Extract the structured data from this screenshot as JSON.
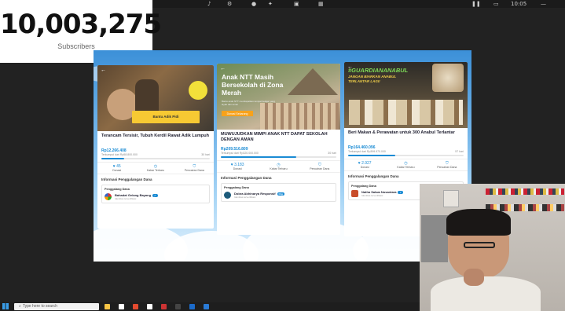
{
  "subscriber_widget": {
    "count": "10,003,275",
    "label": "Subscribers"
  },
  "top_icons": [
    "bell-icon",
    "settings-icon",
    "record-icon",
    "share-icon",
    "window-icon",
    "grid-icon",
    "pause-icon",
    "layout-icon",
    "minimize-icon"
  ],
  "top_time": "10:05",
  "cards": [
    {
      "title": "Terancam Tersisir, Tubuh Kerdil Rawat Adik Lumpuh",
      "banner": "Bantu Adik Pidi",
      "amount": "Rp12.266.408",
      "target": "Terkumpul dari Rp58.800.000",
      "days": "30 hari",
      "progress": 0.21,
      "actions": {
        "count": "45",
        "donasi": "Donasi",
        "kabar": "Kabar Terbaru",
        "pencairan": "Pencairan Dana"
      },
      "info_title": "Informasi Penggalangan Dana",
      "org_label": "Penggalang Dana",
      "org_name": "Bahadat Gelang Bayang",
      "org_badge": "✓",
      "org_sub": "Identitas terverifikasi"
    },
    {
      "hero_title": "Anak NTT Masih Bersekolah di Zona Merah",
      "hero_sub": "Bantu anak NTT mendapatkan tempat belajar yang layak dan aman",
      "hero_button": "Donasi Sekarang",
      "title": "MUWUJUDKAN MIMPI ANAK NTT DAPAT SEKOLAH DENGAN AMAN",
      "amount": "Rp209.516.809",
      "target": "Terkumpul dari Rp320.000.000",
      "days": "30 hari",
      "progress": 0.65,
      "actions": {
        "count": "3.183",
        "donasi": "Donasi",
        "kabar": "Kabar Terbaru",
        "pencairan": "Pencairan Dana"
      },
      "info_title": "Informasi Penggalangan Dana",
      "org_label": "Penggalang Dana",
      "org_name": "Dobra Abhinarya Responsif",
      "org_badge": "Org",
      "org_sub": "Identitas terverifikasi"
    },
    {
      "hero_title": "#GUARDIANANABUL",
      "hero_sub": "JANGAN BIARKAN ANABUL TERLANTAR LAGI!",
      "title": "Beri Makan & Perawatan untuk 300 Anabul Terlantar",
      "amount": "Rp164.460.096",
      "target": "Terkumpul dari Rp399.970.000",
      "days": "57 hari",
      "progress": 0.41,
      "actions": {
        "count": "2.927",
        "donasi": "Donasi",
        "kabar": "Kabar Terbaru",
        "pencairan": "Pencairan Dana"
      },
      "info_title": "Informasi Penggalangan Dana",
      "org_label": "Penggalang Dana",
      "org_name": "Natha Satwa Nusantara",
      "org_badge": "✓",
      "org_sub": "Identitas terverifikasi"
    }
  ],
  "taskbar": {
    "search_placeholder": "Type here to search"
  }
}
